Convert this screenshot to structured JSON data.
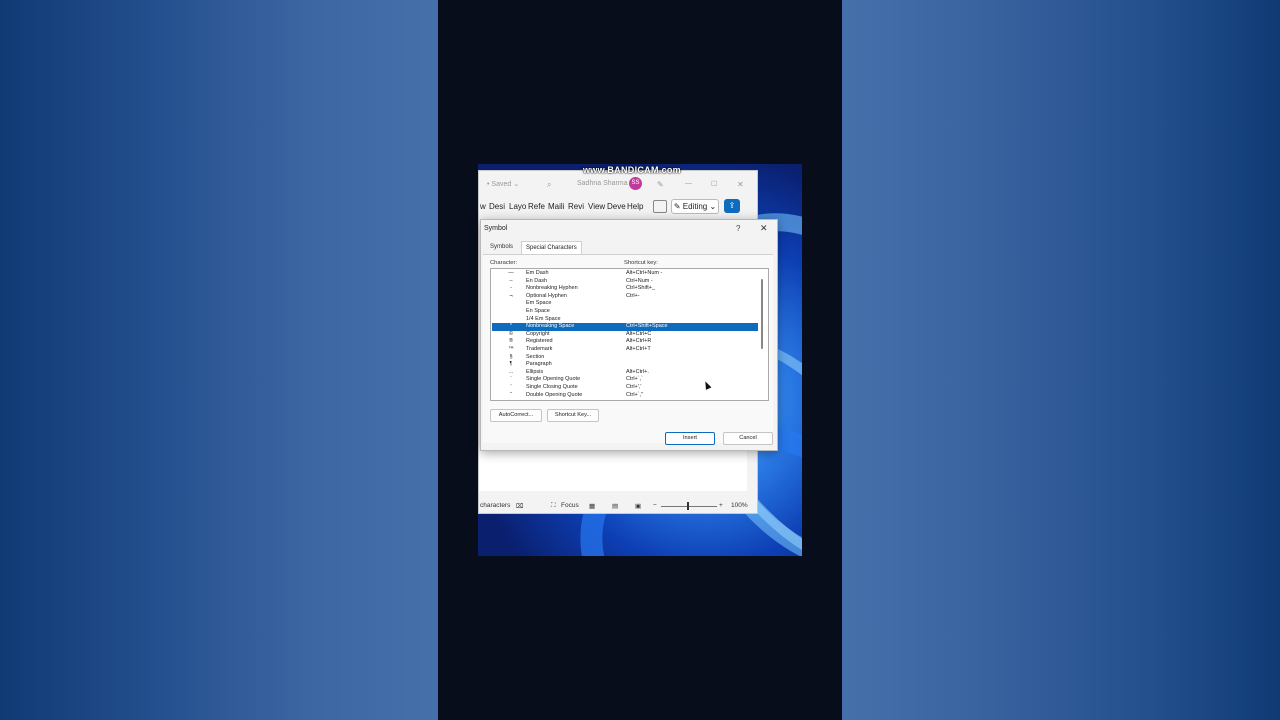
{
  "watermark": "www.BANDICAM.com",
  "word": {
    "saved": "• Saved ⌄",
    "user": "Sadhna Sharma",
    "user_initials": "SS",
    "ribbon_tabs": [
      "w",
      "Desi",
      "Layo",
      "Refe",
      "Maili",
      "Revi",
      "View",
      "Deve",
      "Help"
    ],
    "editing_label": "Editing ⌄",
    "status": {
      "characters": "characters",
      "focus": "Focus",
      "zoom": "100%"
    }
  },
  "dialog": {
    "title": "Symbol",
    "help": "?",
    "close": "✕",
    "tabs": [
      "Symbols",
      "Special Characters"
    ],
    "col_character": "Character:",
    "col_shortcut": "Shortcut key:",
    "rows": [
      {
        "char": "—",
        "name": "Em Dash",
        "shortcut": "Alt+Ctrl+Num -"
      },
      {
        "char": "–",
        "name": "En Dash",
        "shortcut": "Ctrl+Num -"
      },
      {
        "char": "-",
        "name": "Nonbreaking Hyphen",
        "shortcut": "Ctrl+Shift+_"
      },
      {
        "char": "¬",
        "name": "Optional Hyphen",
        "shortcut": "Ctrl+-"
      },
      {
        "char": "",
        "name": "Em Space",
        "shortcut": ""
      },
      {
        "char": "",
        "name": "En Space",
        "shortcut": ""
      },
      {
        "char": "",
        "name": "1/4 Em Space",
        "shortcut": ""
      },
      {
        "char": "°",
        "name": "Nonbreaking Space",
        "shortcut": "Ctrl+Shift+Space",
        "selected": true
      },
      {
        "char": "©",
        "name": "Copyright",
        "shortcut": "Alt+Ctrl+C"
      },
      {
        "char": "®",
        "name": "Registered",
        "shortcut": "Alt+Ctrl+R"
      },
      {
        "char": "™",
        "name": "Trademark",
        "shortcut": "Alt+Ctrl+T"
      },
      {
        "char": "§",
        "name": "Section",
        "shortcut": ""
      },
      {
        "char": "¶",
        "name": "Paragraph",
        "shortcut": ""
      },
      {
        "char": "…",
        "name": "Ellipsis",
        "shortcut": "Alt+Ctrl+."
      },
      {
        "char": "‘",
        "name": "Single Opening Quote",
        "shortcut": "Ctrl+`,`"
      },
      {
        "char": "’",
        "name": "Single Closing Quote",
        "shortcut": "Ctrl+','"
      },
      {
        "char": "“",
        "name": "Double Opening Quote",
        "shortcut": "Ctrl+`,\""
      }
    ],
    "autocorrect_label": "AutoCorrect...",
    "shortcut_key_label": "Shortcut Key...",
    "insert_label": "Insert",
    "cancel_label": "Cancel"
  }
}
